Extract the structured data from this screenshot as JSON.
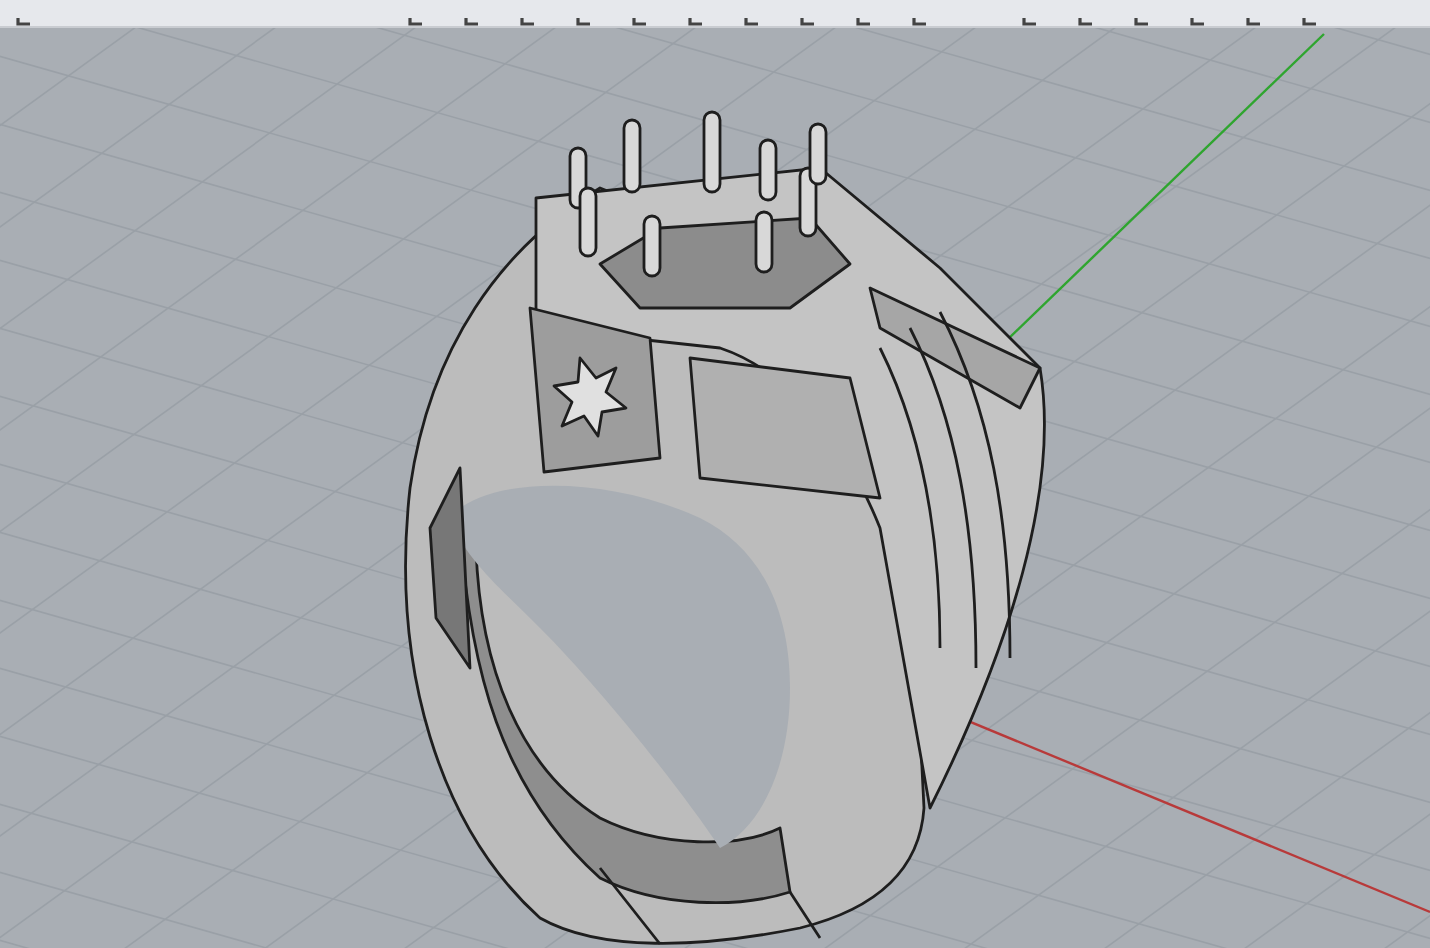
{
  "toolbar": {
    "icons": [
      {
        "kind": "tool"
      },
      {
        "kind": "spacer"
      },
      {
        "kind": "tool"
      },
      {
        "kind": "tool"
      },
      {
        "kind": "tool"
      },
      {
        "kind": "tool"
      },
      {
        "kind": "tool"
      },
      {
        "kind": "tool"
      },
      {
        "kind": "tool"
      },
      {
        "kind": "tool"
      },
      {
        "kind": "tool"
      },
      {
        "kind": "tool"
      },
      {
        "kind": "gap"
      },
      {
        "kind": "tool"
      },
      {
        "kind": "tool"
      },
      {
        "kind": "tool"
      },
      {
        "kind": "tool"
      },
      {
        "kind": "tool"
      },
      {
        "kind": "tool"
      }
    ]
  },
  "viewport": {
    "grid": true,
    "axes": true
  }
}
